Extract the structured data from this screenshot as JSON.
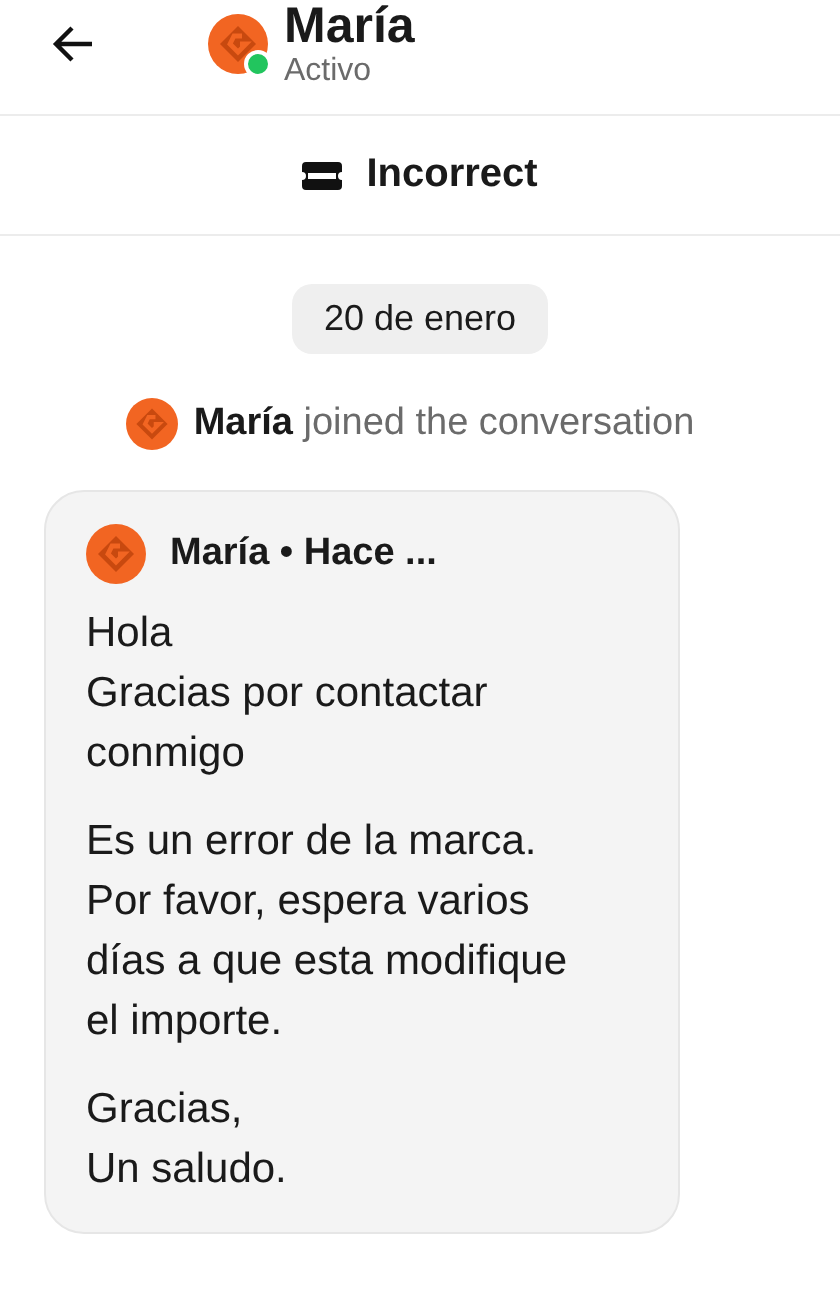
{
  "header": {
    "name": "María",
    "status": "Activo",
    "online": true
  },
  "topic": {
    "label": "Incorrect"
  },
  "date_chip": "20 de enero",
  "event": {
    "text": "**María** joined the conversation"
  },
  "message": {
    "author": "María • Hace ...",
    "paragraphs": [
      "Hola\nGracias por contactar\nconmigo",
      "Es un error de la marca.\nPor favor, espera varios\ndías a que esta modifique\nel importe.",
      "Gracias,\nUn saludo."
    ]
  }
}
